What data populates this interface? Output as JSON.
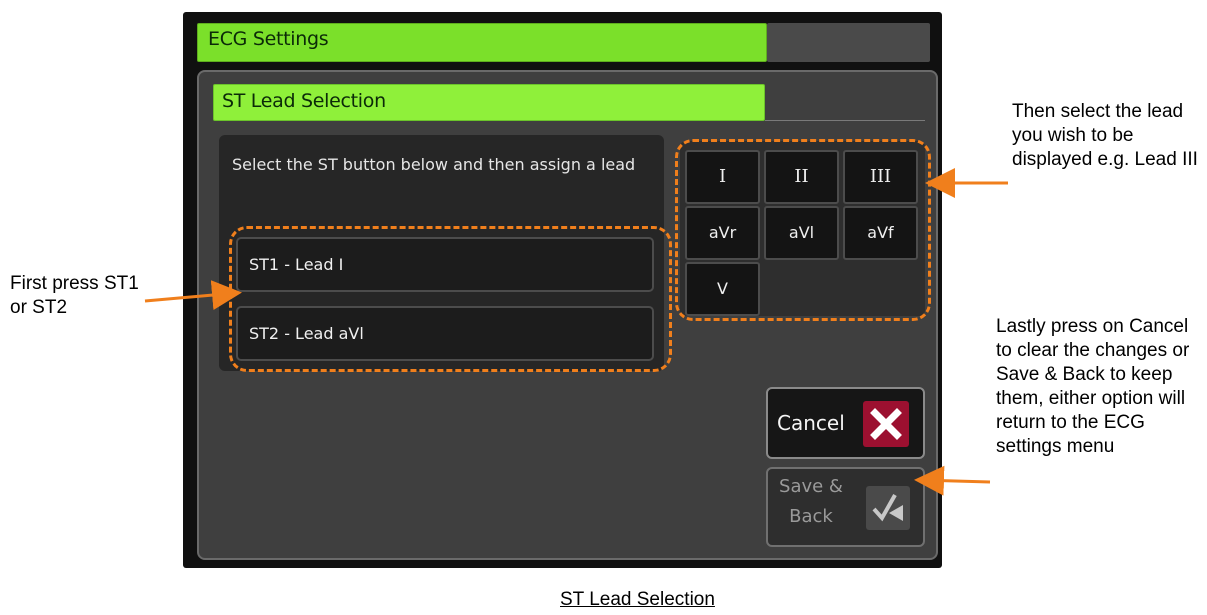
{
  "window": {
    "title": "ECG Settings"
  },
  "panel": {
    "title": "ST Lead Selection",
    "instruction": "Select the ST button below and then assign a lead"
  },
  "st_buttons": [
    {
      "label": "ST1 - Lead I"
    },
    {
      "label": "ST2 - Lead aVl"
    }
  ],
  "leads": [
    "I",
    "II",
    "III",
    "aVr",
    "aVl",
    "aVf",
    "V"
  ],
  "actions": {
    "cancel": {
      "label": "Cancel",
      "icon": "close-icon"
    },
    "save": {
      "label_line1": "Save &",
      "label_line2": "Back",
      "icon": "check-back-icon"
    }
  },
  "annotations": {
    "left_note": "First press ST1 or ST2",
    "right_note": "Then select the lead you wish to be displayed e.g. Lead III",
    "bottom_note": "Lastly press on Cancel to clear the changes or Save & Back to keep them, either option will return to the ECG settings menu",
    "caption": "ST Lead Selection"
  },
  "colors": {
    "title_green": "#7be02a",
    "subtitle_green": "#8ff03a",
    "callout_orange": "#f07f1c",
    "cancel_red": "#9c1030"
  }
}
